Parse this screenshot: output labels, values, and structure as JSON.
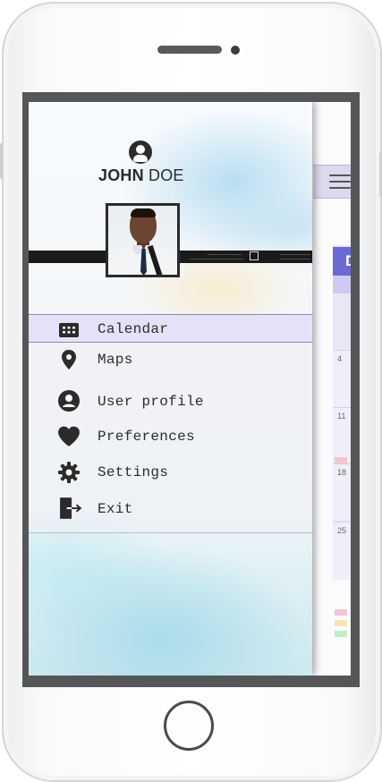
{
  "drawer": {
    "user": {
      "first_name": "JOHN",
      "last_name": "DOE"
    },
    "menu_items": [
      {
        "label": "Calendar",
        "icon": "calendar-icon",
        "active": true
      },
      {
        "label": "Maps",
        "icon": "map-pin-icon",
        "active": false
      },
      {
        "label": "User profile",
        "icon": "user-profile-icon",
        "active": false
      },
      {
        "label": "Preferences",
        "icon": "heart-icon",
        "active": false
      },
      {
        "label": "Settings",
        "icon": "gear-icon",
        "active": false
      },
      {
        "label": "Exit",
        "icon": "exit-icon",
        "active": false
      }
    ]
  },
  "background_app": {
    "calendar_header": "D",
    "week_days": [
      "4",
      "11",
      "18",
      "25"
    ]
  },
  "colors": {
    "accent": "#6a6ad4",
    "active_item_bg": "#e5e1f7",
    "icon": "#2b2b2b"
  }
}
